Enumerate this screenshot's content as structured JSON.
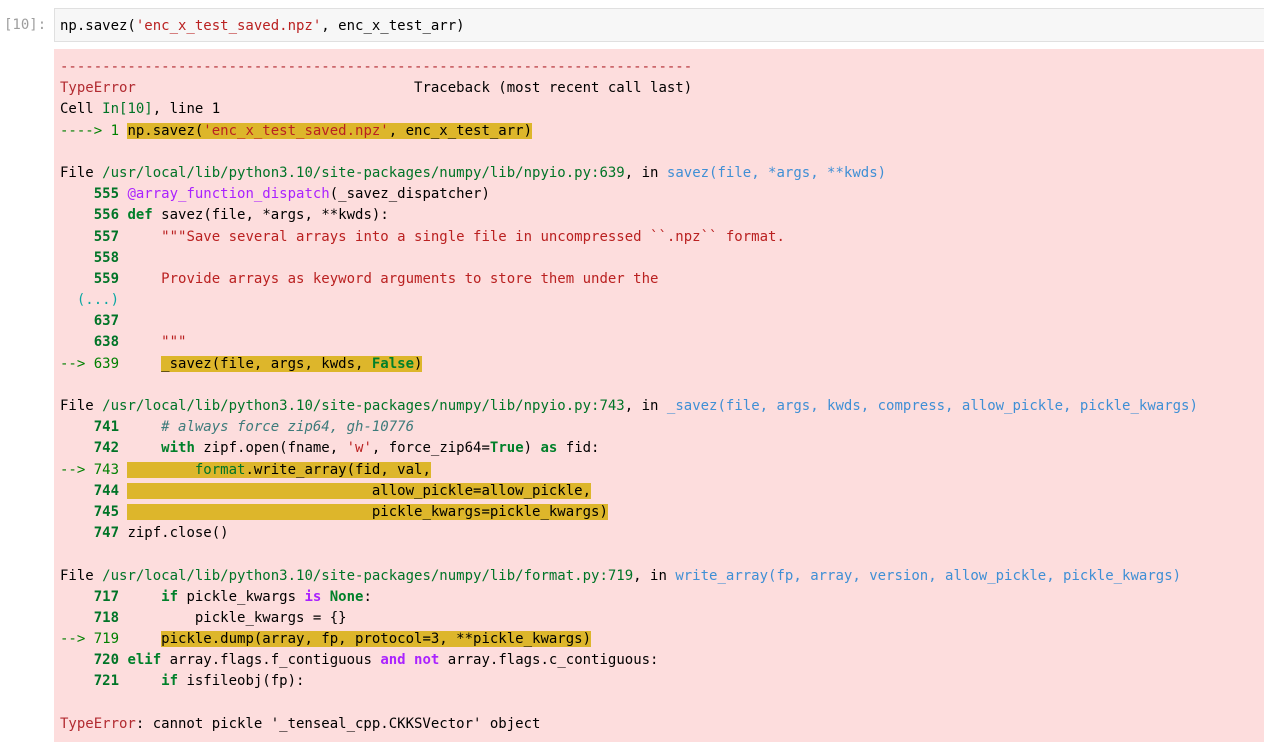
{
  "cell": {
    "prompt": "[10]:",
    "input": {
      "fn": "np.savez(",
      "arg_str": "'enc_x_test_saved.npz'",
      "rest": ", enc_x_test_arr)"
    }
  },
  "traceback": {
    "dashes": "---------------------------------------------------------------------------",
    "error_type": "TypeError",
    "header_pad": "                                 ",
    "header_right": "Traceback (most recent call last)",
    "cell_ref": {
      "prefix": "Cell ",
      "in": "In[10]",
      "suffix": ", line 1"
    },
    "top_arrow": "----> 1 ",
    "top_code": {
      "fn": "np.savez(",
      "str": "'enc_x_test_saved.npz'",
      "rest": ", enc_x_test_arr)"
    },
    "frame1": {
      "file_prefix": "File ",
      "path": "/usr/local/lib/python3.10/site-packages/numpy/lib/npyio.py:639",
      "in_word": ", in ",
      "func": "savez(file, *args, **kwds)",
      "l555_no": "    555 ",
      "l555_dec": "@array_function_dispatch",
      "l555_rest": "(_savez_dispatcher)",
      "l556_no": "    556 ",
      "l556_kw": "def",
      "l556_fn": " savez",
      "l556_rest": "(file, *args, **kwds):",
      "l557_no": "    557 ",
      "l557_text": "    \"\"\"Save several arrays into a single file in uncompressed ``.npz`` format.",
      "l558_no": "    558 ",
      "l559_no": "    559 ",
      "l559_text": "    Provide arrays as keyword arguments to store them under the",
      "ellipsis": "  (...)",
      "l637_no": "    637 ",
      "l638_no": "    638 ",
      "l638_text": "    \"\"\"",
      "l639_arrow": "--> 639 ",
      "l639_indent": "    ",
      "l639_code": "_savez(file, args, kwds, ",
      "l639_kw": "False",
      "l639_end": ")"
    },
    "frame2": {
      "file_prefix": "File ",
      "path": "/usr/local/lib/python3.10/site-packages/numpy/lib/npyio.py:743",
      "in_word": ", in ",
      "func": "_savez(file, args, kwds, compress, allow_pickle, pickle_kwargs)",
      "l741_no": "    741 ",
      "l741_text": "    # always force zip64, gh-10776",
      "l742_no": "    742 ",
      "l742_indent": "    ",
      "l742_kw": "with",
      "l742_a": " zipf.open(fname, ",
      "l742_str": "'w'",
      "l742_b": ", force_zip64=",
      "l742_kw2": "True",
      "l742_c": ") ",
      "l742_kw3": "as",
      "l742_d": " fid:",
      "l743_arrow": "--> 743 ",
      "l743_indent": "        ",
      "l743_mod": "format",
      "l743_rest": ".write_array(fid, val,",
      "l744_no": "    744 ",
      "l744_text": "                             allow_pickle=allow_pickle,",
      "l745_no": "    745 ",
      "l745_text": "                             pickle_kwargs=pickle_kwargs)",
      "l747_no": "    747 ",
      "l747_text": "zipf.close()"
    },
    "frame3": {
      "file_prefix": "File ",
      "path": "/usr/local/lib/python3.10/site-packages/numpy/lib/format.py:719",
      "in_word": ", in ",
      "func": "write_array(fp, array, version, allow_pickle, pickle_kwargs)",
      "l717_no": "    717 ",
      "l717_indent": "    ",
      "l717_kw": "if",
      "l717_a": " pickle_kwargs ",
      "l717_kw2": "is",
      "l717_sp": " ",
      "l717_kw3": "None",
      "l717_b": ":",
      "l718_no": "    718 ",
      "l718_text": "        pickle_kwargs = {}",
      "l719_arrow": "--> 719 ",
      "l719_indent": "    ",
      "l719_code": "pickle.dump(array, fp, protocol=3, **pickle_kwargs)",
      "l720_no": "    720 ",
      "l720_kw": "elif",
      "l720_a": " array.flags.f_contiguous ",
      "l720_kw2": "and",
      "l720_sp": " ",
      "l720_kw3": "not",
      "l720_b": " array.flags.c_contiguous:",
      "l721_no": "    721 ",
      "l721_indent": "    ",
      "l721_kw": "if",
      "l721_b": " isfileobj(fp):"
    },
    "final_type": "TypeError",
    "final_msg": ": cannot pickle '_tenseal_cpp.CKKSVector' object"
  }
}
